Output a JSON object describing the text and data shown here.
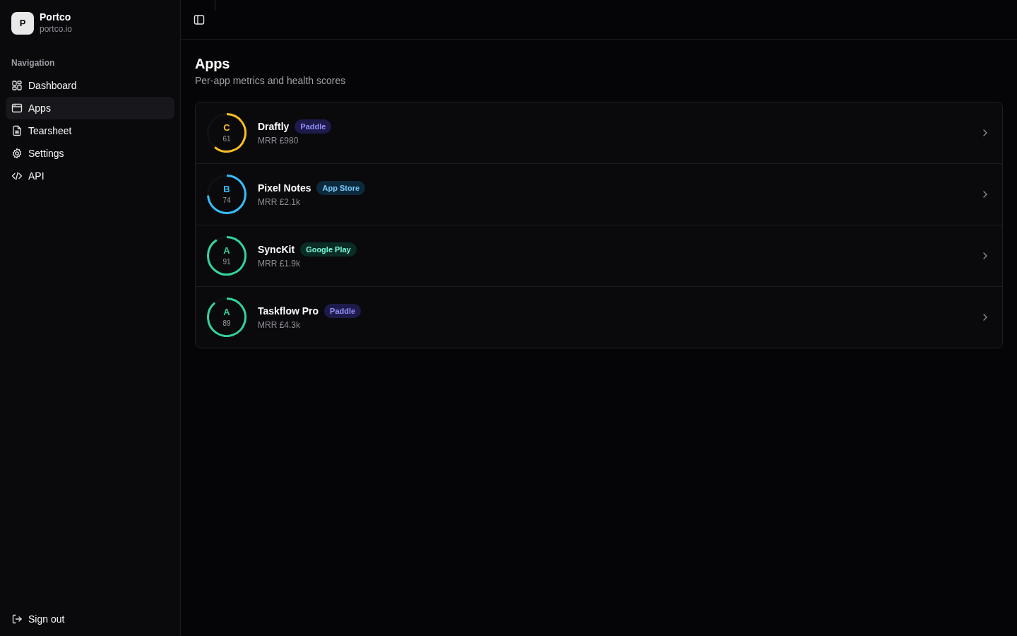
{
  "brand": {
    "initial": "P",
    "name": "Portco",
    "domain": "portco.io"
  },
  "sidebar": {
    "section_label": "Navigation",
    "items": [
      {
        "label": "Dashboard",
        "selected": false
      },
      {
        "label": "Apps",
        "selected": true
      },
      {
        "label": "Tearsheet",
        "selected": false
      },
      {
        "label": "Settings",
        "selected": false
      },
      {
        "label": "API",
        "selected": false
      }
    ],
    "sign_out": "Sign out"
  },
  "page": {
    "title": "Apps",
    "subtitle": "Per-app metrics and health scores"
  },
  "apps": [
    {
      "grade": "C",
      "score": "61",
      "color": "#fbbf24",
      "name": "Draftly",
      "badge": {
        "label": "Paddle",
        "color": "#1e1b4b"
      },
      "mrr": "MRR £980"
    },
    {
      "grade": "B",
      "score": "74",
      "color": "#38bdf8",
      "name": "Pixel Notes",
      "badge": {
        "label": "App Store",
        "color": "#0c2a3c"
      },
      "mrr": "MRR £2.1k"
    },
    {
      "grade": "A",
      "score": "91",
      "color": "#34d399",
      "name": "SyncKit",
      "badge": {
        "label": "Google Play",
        "color": "#0a2c24"
      },
      "mrr": "MRR £1.9k"
    },
    {
      "grade": "A",
      "score": "89",
      "color": "#34d399",
      "name": "Taskflow Pro",
      "badge": {
        "label": "Paddle",
        "color": "#1e1b4b"
      },
      "mrr": "MRR £4.3k"
    }
  ]
}
